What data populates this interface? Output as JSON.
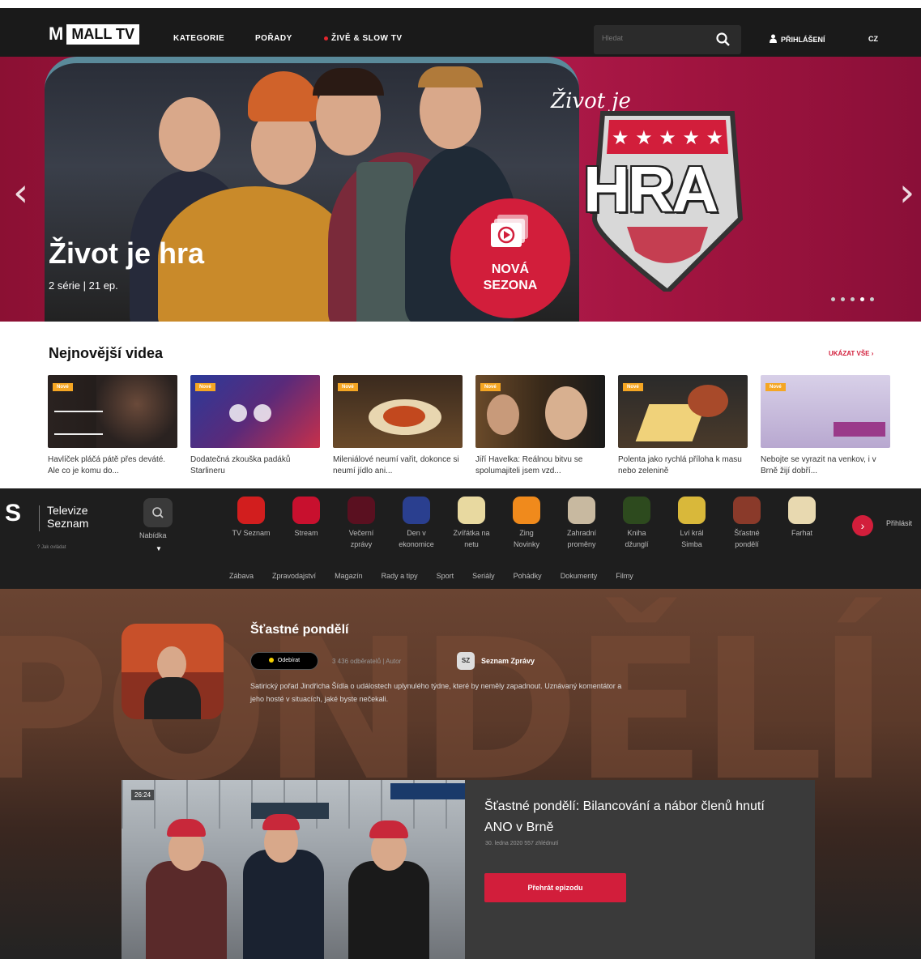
{
  "mall": {
    "logo_prefix": "M",
    "logo_box": "MALL TV",
    "nav": [
      "KATEGORIE",
      "POŘADY",
      "ŽIVĚ & SLOW TV"
    ],
    "search_placeholder": "Hledat",
    "login": "PŘIHLÁŠENÍ",
    "lang": "CZ",
    "hero": {
      "title": "Život je hra",
      "subtitle": "2 série | 21 ep.",
      "badge_line1": "NOVÁ",
      "badge_line2": "SEZONA",
      "logo_script": "Život je",
      "logo_word": "HRA",
      "slides_total": 5,
      "slide_active_index": 3
    },
    "section_title": "Nejnovější videa",
    "show_all": "UKÁZAT VŠE",
    "videos": [
      {
        "badge": "Nové",
        "title": "Havlíček pláčá pátě přes deváté. Ale co je komu do..."
      },
      {
        "badge": "Nové",
        "title": "Dodatečná zkouška padáků Starlineru"
      },
      {
        "badge": "Nové",
        "title": "Mileniálové neumí vařit, dokonce si neumí jídlo ani..."
      },
      {
        "badge": "Nové",
        "title": "Jiří Havelka: Reálnou bitvu se spolumajiteli jsem vzd..."
      },
      {
        "badge": "Nové",
        "title": "Polenta jako rychlá příloha k masu nebo zelenině"
      },
      {
        "badge": "Nové",
        "title": "Nebojte se vyrazit na venkov, i v Brně žijí dobří..."
      }
    ]
  },
  "seznam": {
    "logo_line1": "Televize",
    "logo_line2": "Seznam",
    "nabidka": "Nabídka",
    "channels": [
      {
        "label1": "TV Seznam",
        "label2": "",
        "color": "#d21e1e"
      },
      {
        "label1": "Stream",
        "label2": "",
        "color": "#c8102e"
      },
      {
        "label1": "Večerní",
        "label2": "zprávy",
        "color": "#5a1020"
      },
      {
        "label1": "Den v",
        "label2": "ekonomice",
        "color": "#2a3f8f"
      },
      {
        "label1": "Zvířátka na",
        "label2": "netu",
        "color": "#e8d9a0"
      },
      {
        "label1": "Zing",
        "label2": "Novinky",
        "color": "#f08a1c"
      },
      {
        "label1": "Zahradní",
        "label2": "proměny",
        "color": "#c8b9a0"
      },
      {
        "label1": "Kniha",
        "label2": "džunglí",
        "color": "#2d4a1e"
      },
      {
        "label1": "Lví král",
        "label2": "Simba",
        "color": "#d9b83a"
      },
      {
        "label1": "Šťastné",
        "label2": "pondělí",
        "color": "#8a3a2a"
      },
      {
        "label1": "Farhat",
        "label2": "",
        "color": "#e8d9b0"
      }
    ],
    "login": "Přihlásit",
    "categories": [
      "Zábava",
      "Zpravodajství",
      "Magazín",
      "Rady a tipy",
      "Sport",
      "Seriály",
      "Pohádky",
      "Dokumenty",
      "Filmy"
    ],
    "show": {
      "title": "Šťastné pondělí",
      "subscribe": "Odebírat",
      "subscribers": "3 436 odběratelů | Autor",
      "author_badge": "SZ",
      "author": "Seznam Zprávy",
      "description": "Satirický pořad Jindřicha Šídla o událostech uplynulého týdne, které by neměly zapadnout. Uznávaný komentátor a jeho hosté v situacích, jaké byste nečekali.",
      "bg_word": "PONDĚLÍ"
    },
    "episode": {
      "duration": "26:24",
      "title": "Šťastné pondělí: Bilancování a nábor členů hnutí ANO v Brně",
      "meta": "30. ledna 2020   557 zhlédnutí",
      "play": "Přehrát epizodu"
    }
  }
}
